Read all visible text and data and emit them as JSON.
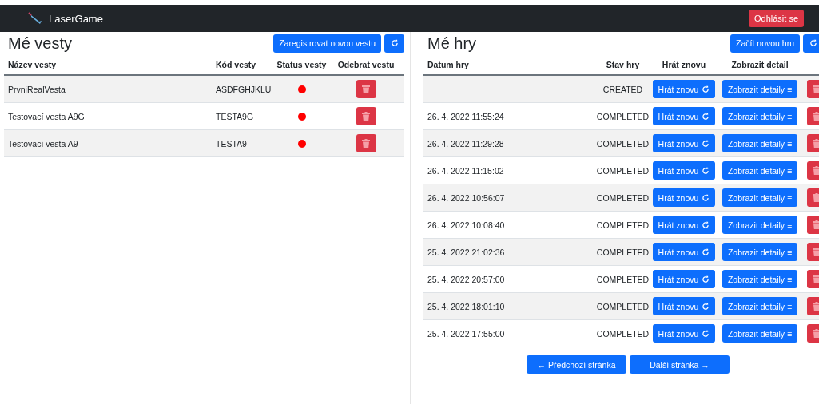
{
  "navbar": {
    "brand": "LaserGame",
    "logout": "Odhlásit se"
  },
  "vests": {
    "title": "Mé vesty",
    "register_button": "Zaregistrovat novou vestu",
    "columns": [
      "Název vesty",
      "Kód vesty",
      "Status vesty",
      "Odebrat vestu"
    ],
    "rows": [
      {
        "name": "PrvniRealVesta",
        "code": "ASDFGHJKLU",
        "color": "#ff0000"
      },
      {
        "name": "Testovací vesta A9G",
        "code": "TESTA9G",
        "color": "#ff0000"
      },
      {
        "name": "Testovací vesta A9",
        "code": "TESTA9",
        "color": "#ff0000"
      }
    ]
  },
  "games": {
    "title": "Mé hry",
    "new_button": "Začít novou hru",
    "columns": [
      "Datum hry",
      "Stav hry",
      "Hrát znovu",
      "Zobrazit detail"
    ],
    "rows": [
      {
        "state": "CREATED",
        "replay": "Hrát znovu",
        "detail": "Zobrazit detaily ≡"
      },
      {
        "date": "26. 4. 2022 11:55:24",
        "state": "COMPLETED",
        "replay": "Hrát znovu",
        "detail": "Zobrazit detaily ≡"
      },
      {
        "date": "26. 4. 2022 11:29:28",
        "state": "COMPLETED",
        "replay": "Hrát znovu",
        "detail": "Zobrazit detaily ≡"
      },
      {
        "date": "26. 4. 2022 11:15:02",
        "state": "COMPLETED",
        "replay": "Hrát znovu",
        "detail": "Zobrazit detaily ≡"
      },
      {
        "date": "26. 4. 2022 10:56:07",
        "state": "COMPLETED",
        "replay": "Hrát znovu",
        "detail": "Zobrazit detaily ≡"
      },
      {
        "date": "26. 4. 2022 10:08:40",
        "state": "COMPLETED",
        "replay": "Hrát znovu",
        "detail": "Zobrazit detaily ≡"
      },
      {
        "date": "25. 4. 2022 21:02:36",
        "state": "COMPLETED",
        "replay": "Hrát znovu",
        "detail": "Zobrazit detaily ≡"
      },
      {
        "date": "25. 4. 2022 20:57:00",
        "state": "COMPLETED",
        "replay": "Hrát znovu",
        "detail": "Zobrazit detaily ≡"
      },
      {
        "date": "25. 4. 2022 18:01:10",
        "state": "COMPLETED",
        "replay": "Hrát znovu",
        "detail": "Zobrazit detaily ≡"
      },
      {
        "date": "25. 4. 2022 17:55:00",
        "state": "COMPLETED",
        "replay": "Hrát znovu",
        "detail": "Zobrazit detaily ≡"
      }
    ],
    "prev_button": "← Předchozí stránka",
    "next_button": "Další stránka →"
  }
}
